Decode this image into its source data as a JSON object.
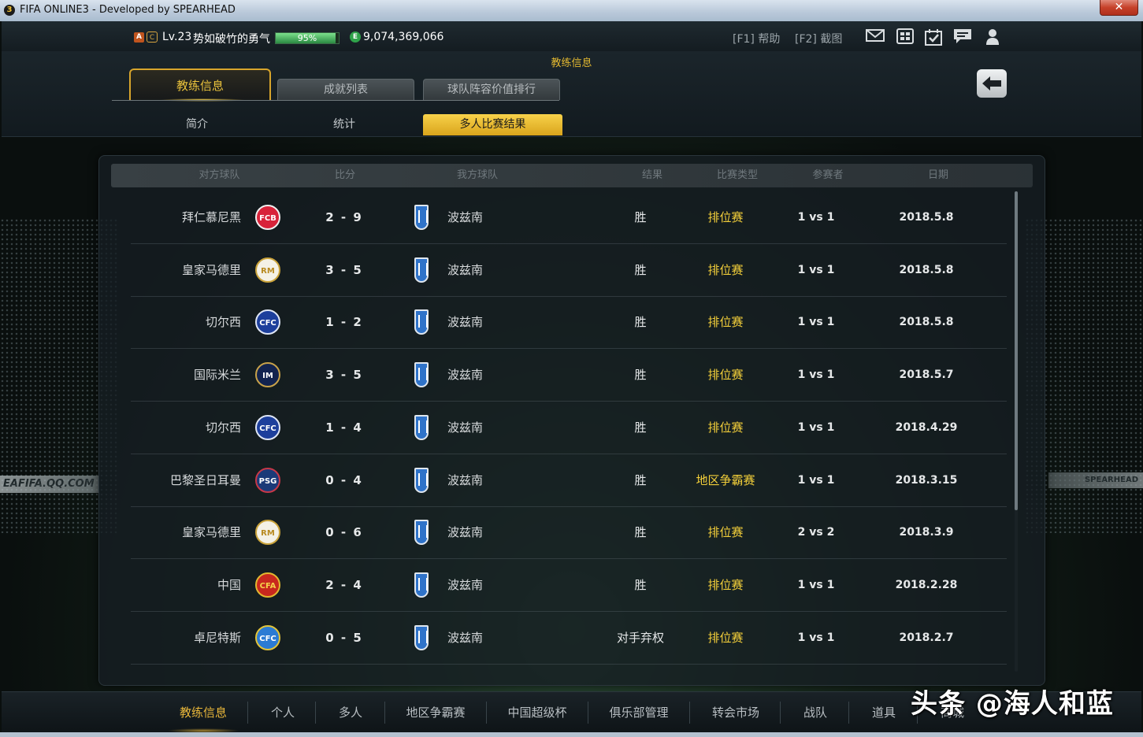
{
  "window": {
    "title": "FIFA ONLINE3 - Developed by SPEARHEAD",
    "app_icon": "3",
    "close_label": "✕"
  },
  "status": {
    "rank_badge": "A",
    "club_badge": "C",
    "level": "Lv.23",
    "nickname": "势如破竹的勇气",
    "exp_percent_label": "95%",
    "exp_fraction": 0.95,
    "coin_icon": "E",
    "coins": "9,074,369,066",
    "help": "[F1] 帮助",
    "screenshot": "[F2] 截图",
    "icons": [
      "mail-icon",
      "calendar-icon",
      "checkin-icon",
      "chat-icon",
      "profile-icon"
    ]
  },
  "header": {
    "section_title": "教练信息",
    "tabs": [
      {
        "label": "教练信息",
        "active": true
      },
      {
        "label": "成就列表",
        "active": false
      },
      {
        "label": "球队阵容价值排行",
        "active": false
      }
    ],
    "subtabs": [
      {
        "label": "简介",
        "active": false
      },
      {
        "label": "统计",
        "active": false
      },
      {
        "label": "多人比赛结果",
        "active": true
      }
    ],
    "back_icon": "back-arrow-icon"
  },
  "table": {
    "columns": [
      "对方球队",
      "比分",
      "我方球队",
      "结果",
      "比赛类型",
      "参赛者",
      "日期"
    ],
    "rows": [
      {
        "opponent": "拜仁慕尼黑",
        "crest": "bayern",
        "score": "2 - 9",
        "mine": "波兹南",
        "result": "胜",
        "type": "排位赛",
        "players": "1 vs 1",
        "date": "2018.5.8"
      },
      {
        "opponent": "皇家马德里",
        "crest": "real",
        "score": "3 - 5",
        "mine": "波兹南",
        "result": "胜",
        "type": "排位赛",
        "players": "1 vs 1",
        "date": "2018.5.8"
      },
      {
        "opponent": "切尔西",
        "crest": "chelsea",
        "score": "1 - 2",
        "mine": "波兹南",
        "result": "胜",
        "type": "排位赛",
        "players": "1 vs 1",
        "date": "2018.5.8"
      },
      {
        "opponent": "国际米兰",
        "crest": "inter",
        "score": "3 - 5",
        "mine": "波兹南",
        "result": "胜",
        "type": "排位赛",
        "players": "1 vs 1",
        "date": "2018.5.7"
      },
      {
        "opponent": "切尔西",
        "crest": "chelsea",
        "score": "1 - 4",
        "mine": "波兹南",
        "result": "胜",
        "type": "排位赛",
        "players": "1 vs 1",
        "date": "2018.4.29"
      },
      {
        "opponent": "巴黎圣日耳曼",
        "crest": "psg",
        "score": "0 - 4",
        "mine": "波兹南",
        "result": "胜",
        "type": "地区争霸赛",
        "players": "1 vs 1",
        "date": "2018.3.15"
      },
      {
        "opponent": "皇家马德里",
        "crest": "real",
        "score": "0 - 6",
        "mine": "波兹南",
        "result": "胜",
        "type": "排位赛",
        "players": "2 vs 2",
        "date": "2018.3.9"
      },
      {
        "opponent": "中国",
        "crest": "china",
        "score": "2 - 4",
        "mine": "波兹南",
        "result": "胜",
        "type": "排位赛",
        "players": "1 vs 1",
        "date": "2018.2.28"
      },
      {
        "opponent": "卓尼特斯",
        "crest": "chemnitzer",
        "score": "0 - 5",
        "mine": "波兹南",
        "result": "对手弃权",
        "type": "排位赛",
        "players": "1 vs 1",
        "date": "2018.2.7"
      }
    ]
  },
  "bottom_nav": {
    "items": [
      {
        "label": "教练信息",
        "active": true
      },
      {
        "label": "个人",
        "active": false
      },
      {
        "label": "多人",
        "active": false
      },
      {
        "label": "地区争霸赛",
        "active": false
      },
      {
        "label": "中国超级杯",
        "active": false
      },
      {
        "label": "俱乐部管理",
        "active": false
      },
      {
        "label": "转会市场",
        "active": false
      },
      {
        "label": "战队",
        "active": false
      },
      {
        "label": "道具",
        "active": false
      },
      {
        "label": "商城",
        "active": false
      }
    ]
  },
  "background": {
    "board_left": "EAFIFA.QQ.COM",
    "board_right": "SPEARHEAD"
  },
  "watermark": "头条 @海人和蓝",
  "colors": {
    "accent_gold": "#e9c23c",
    "type_yellow": "#f3cf3a",
    "exp_green": "#2a8a42"
  }
}
